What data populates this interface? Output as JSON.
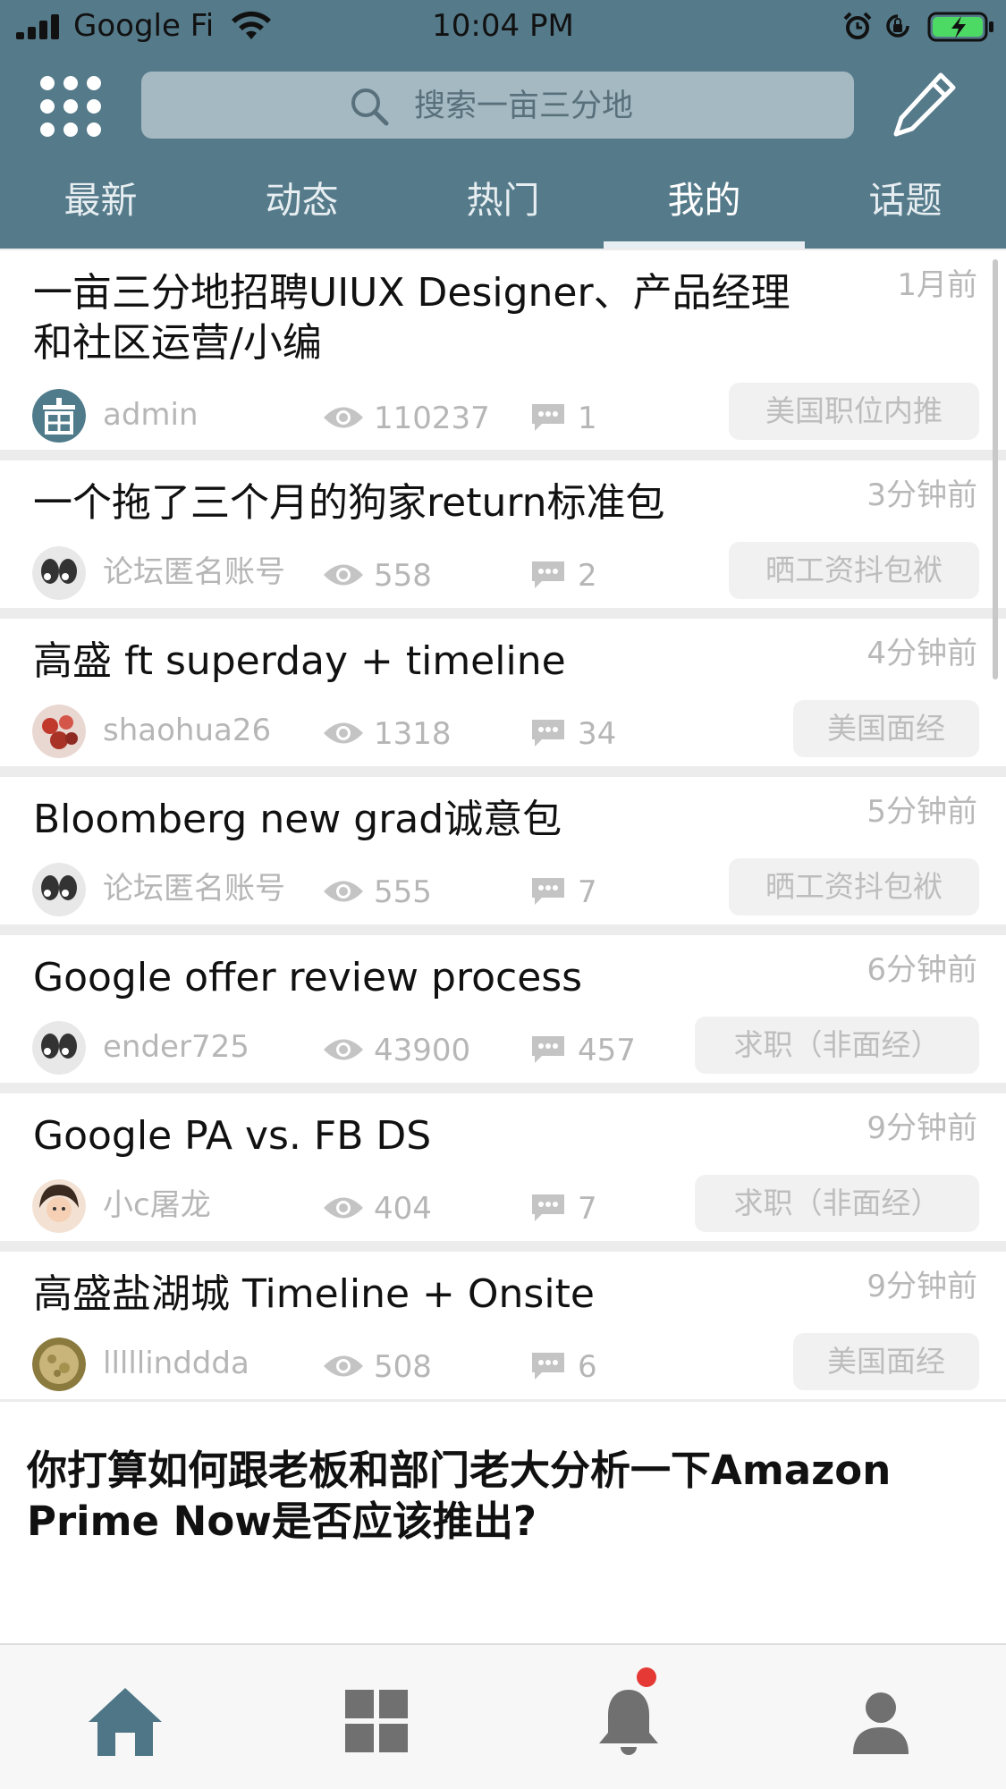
{
  "status_bar": {
    "carrier": "Google Fi",
    "time": "10:04 PM"
  },
  "header": {
    "search_placeholder": "搜索一亩三分地",
    "tabs": [
      {
        "label": "最新"
      },
      {
        "label": "动态"
      },
      {
        "label": "热门"
      },
      {
        "label": "我的"
      },
      {
        "label": "话题"
      }
    ],
    "active_tab": "我的"
  },
  "posts": [
    {
      "title": "一亩三分地招聘UIUX Designer、产品经理和社区运营/小编",
      "time": "1月前",
      "author": "admin",
      "views": "110237",
      "comments": "1",
      "tag": "美国职位内推"
    },
    {
      "title": "一个拖了三个月的狗家return标准包",
      "time": "3分钟前",
      "author": "论坛匿名账号",
      "views": "558",
      "comments": "2",
      "tag": "晒工资抖包袱"
    },
    {
      "title": "高盛 ft superday + timeline",
      "time": "4分钟前",
      "author": "shaohua26",
      "views": "1318",
      "comments": "34",
      "tag": "美国面经"
    },
    {
      "title": "Bloomberg new grad诚意包",
      "time": "5分钟前",
      "author": "论坛匿名账号",
      "views": "555",
      "comments": "7",
      "tag": "晒工资抖包袱"
    },
    {
      "title": "Google offer review process",
      "time": "6分钟前",
      "author": "ender725",
      "views": "43900",
      "comments": "457",
      "tag": "求职（非面经）"
    },
    {
      "title": "Google PA vs. FB DS",
      "time": "9分钟前",
      "author": "小c屠龙",
      "views": "404",
      "comments": "7",
      "tag": "求职（非面经）"
    },
    {
      "title": "高盛盐湖城 Timeline + Onsite",
      "time": "9分钟前",
      "author": "lllllinddda",
      "views": "508",
      "comments": "6",
      "tag": "美国面经"
    }
  ],
  "banner_post": {
    "title": "你打算如何跟老板和部门老大分析一下Amazon Prime Now是否应该推出?"
  },
  "bottom_nav": [
    {
      "icon": "home-icon"
    },
    {
      "icon": "grid-icon"
    },
    {
      "icon": "bell-icon"
    },
    {
      "icon": "person-icon"
    }
  ],
  "colors": {
    "header": "#557a8a",
    "accent": "#4e7686",
    "notification": "#e53935"
  }
}
